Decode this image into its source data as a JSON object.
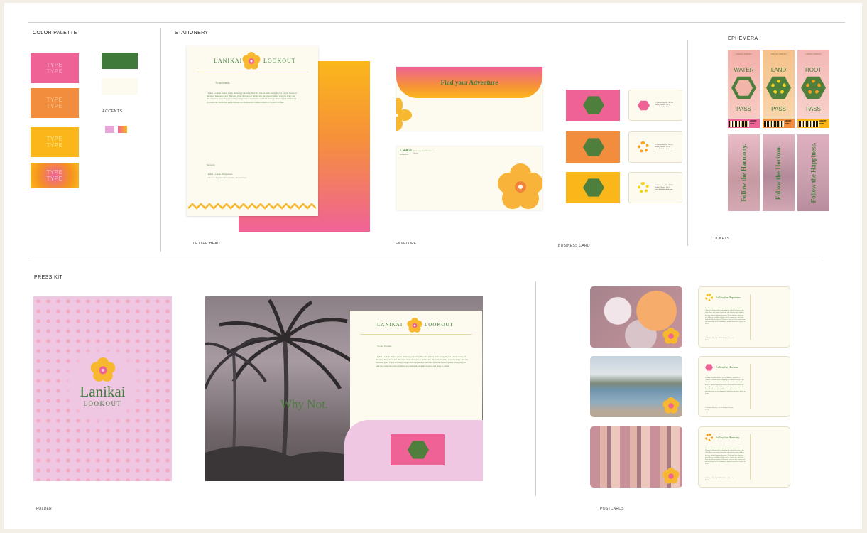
{
  "colors": {
    "pink": "#ef6296",
    "orange": "#f18d3c",
    "yellow": "#fbb71a",
    "green": "#3f7a3b",
    "cream": "#fdfbef",
    "lilac": "#efc7e2"
  },
  "sections": {
    "color_palette": "COLOR PALETTE",
    "stationery": "STATIONERY",
    "ephemera": "EPHEMERA",
    "press_kit": "PRESS KIT"
  },
  "palette": {
    "swatch_text_1": "TYPE",
    "swatch_text_2": "TYPE",
    "accents": "ACCENTS"
  },
  "sublabels": {
    "letterhead": "LETTER HEAD",
    "envelope": "ENVELOPE",
    "business_card": "BUSINESS CARD",
    "tickets": "TICKETS",
    "folder": "FOLDER",
    "postcards": "POSTCARDS"
  },
  "brand": {
    "word1": "LANIKAI",
    "word2": "LOOKOUT",
    "script_name": "Lanikai",
    "script_sub": "LOOKOUT"
  },
  "letter": {
    "greeting": "To our friends,",
    "body": "Lanikai Lookout invites you to immerse yourself in Hawaii's vibrant shifts wrapping the natural beauty of the shore lines and warm Hawaiian vibes that beckon further into the natural fantasy sessions. Early and late wherever goes! Enjoy scrolling foliage and or experience and hold from the blessed glance Whatever you seek the connection and adventure as a destination Lanikai lookout is a place to refuel.",
    "closing": "Sincerely,",
    "signature": "Lanikai Lookout Management",
    "address": "12 Kailua Bay Rd. 96734 Kailua, Hawaii USA"
  },
  "envelope": {
    "flap_text": "Find your Adventure",
    "return_name": "Lanikai",
    "return_sub": "LOOKOUT",
    "return_addr": "1234 Kailua Rd 96734 Kailua, Hawaii"
  },
  "card": {
    "addr1": "12 Kailua Bay Rd. 96734",
    "addr2": "Kailua, Hawaii USA",
    "web": "www.lanikailookout.com"
  },
  "tickets": [
    {
      "title": "WATER",
      "pass": "PASS",
      "admit": "ADMIT ONE"
    },
    {
      "title": "LAND",
      "pass": "PASS",
      "admit": "ADMIT ONE"
    },
    {
      "title": "ROOT",
      "pass": "PASS",
      "admit": "ADMIT ONE"
    }
  ],
  "ticket_brand": "LANIKAI LOOKOUT",
  "vtickets": [
    "Follow the Harmony.",
    "Follow the Horizon.",
    "Follow the Happiness."
  ],
  "presskit": {
    "tagline": "Why Not."
  },
  "postcards": [
    {
      "title": "Follow the Happiness."
    },
    {
      "title": "Follow the Horizon."
    },
    {
      "title": "Follow the Harmony."
    }
  ]
}
